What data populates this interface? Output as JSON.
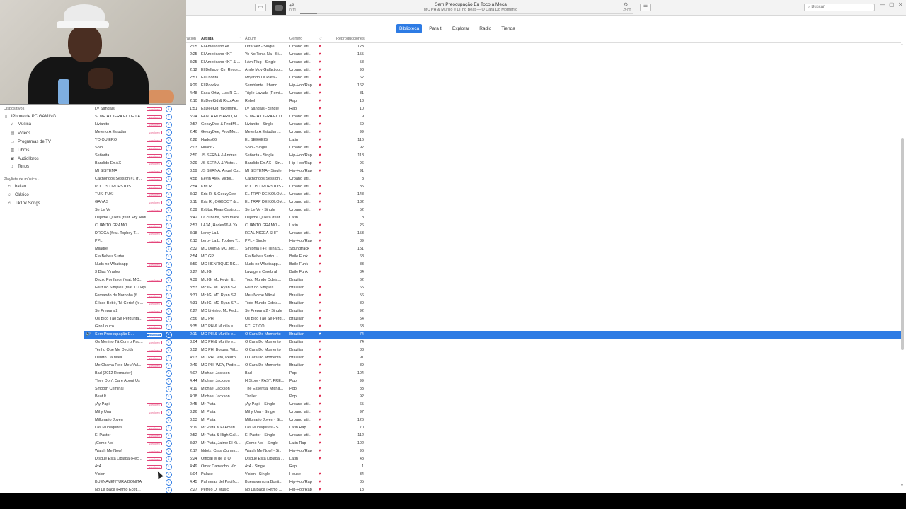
{
  "player": {
    "track_title": "Sem Preocupação Eu Toco a Meca",
    "track_subtitle": "MC PH & Murillo e LT no Beat — O Cara Do Momento",
    "elapsed": "0:11",
    "remaining": "-2:00",
    "progress_fraction": 0.05,
    "search_placeholder": "Buscar"
  },
  "tabs": [
    {
      "label": "Biblioteca",
      "active": true
    },
    {
      "label": "Para ti",
      "active": false
    },
    {
      "label": "Explorar",
      "active": false
    },
    {
      "label": "Radio",
      "active": false
    },
    {
      "label": "Tienda",
      "active": false
    }
  ],
  "sidebar": {
    "devices_heading": "Dispositivos",
    "device_name": "iPhone de PC GAMING",
    "device_items": [
      "Música",
      "Videos",
      "Programas de TV",
      "Libros",
      "Audiolibros",
      "Tonos"
    ],
    "playlists_heading": "Playlists de música",
    "playlists": [
      "bailao",
      "Clásico",
      "TikTok Songs"
    ]
  },
  "columns": {
    "duration": "ración",
    "artist": "Artista",
    "album": "Álbum",
    "genre": "Género",
    "plays": "Reproducciones"
  },
  "explicit_label": "EXPLÍCITO",
  "songs": [
    {
      "name": "",
      "explicit": false,
      "cloud": false,
      "time": "2:05",
      "artist": "El Americano 4KT",
      "album": "Otra Vez - Single",
      "genre": "Urbano lati...",
      "loved": true,
      "plays": "123"
    },
    {
      "name": "",
      "explicit": false,
      "cloud": false,
      "time": "2:25",
      "artist": "El Americano 4KT",
      "album": "Yo No Tenia Na - Si...",
      "genre": "Urbano lati...",
      "loved": true,
      "plays": "155"
    },
    {
      "name": "",
      "explicit": false,
      "cloud": false,
      "time": "3:25",
      "artist": "El Americano 4KT & ...",
      "album": "I Am Plug - Single",
      "genre": "Urbano lati...",
      "loved": true,
      "plays": "58"
    },
    {
      "name": "",
      "explicit": false,
      "cloud": false,
      "time": "2:12",
      "artist": "El Bellaco, Cm Recor...",
      "album": "Ando Muy Galáctico...",
      "genre": "Urbano lati...",
      "loved": true,
      "plays": "93"
    },
    {
      "name": "",
      "explicit": false,
      "cloud": false,
      "time": "2:51",
      "artist": "El Chonta",
      "album": "Mojando La Rata - ...",
      "genre": "Urbano lati...",
      "loved": true,
      "plays": "62"
    },
    {
      "name": "",
      "explicit": false,
      "cloud": false,
      "time": "4:29",
      "artist": "El Roockie",
      "album": "Semblante Urbano",
      "genre": "Hip-Hop/Rap",
      "loved": true,
      "plays": "162"
    },
    {
      "name": "",
      "explicit": false,
      "cloud": false,
      "time": "4:48",
      "artist": "Esau Ortiz, Luis R C...",
      "album": "Triple Lavada (Remi...",
      "genre": "Urbano lati...",
      "loved": true,
      "plays": "81"
    },
    {
      "name": "",
      "explicit": false,
      "cloud": false,
      "time": "2:10",
      "artist": "EsDeeKid & Rico Ace",
      "album": "Rebel",
      "genre": "Rap",
      "loved": true,
      "plays": "13"
    },
    {
      "name": "LV Sandals",
      "explicit": true,
      "cloud": true,
      "time": "1:51",
      "artist": "EsDeeKid, fakemink...",
      "album": "LV Sandals - Single",
      "genre": "Rap",
      "loved": true,
      "plays": "10"
    },
    {
      "name": "SI ME HICIERA EL DE LA...",
      "explicit": true,
      "cloud": true,
      "time": "5:24",
      "artist": "FANTA ROSARIO, H...",
      "album": "SI ME HICIERA EL D...",
      "genre": "Urbano lati...",
      "loved": true,
      "plays": "9"
    },
    {
      "name": "Livianito",
      "explicit": true,
      "cloud": true,
      "time": "2:57",
      "artist": "GeezyDee & ProdM...",
      "album": "Livianito - Single",
      "genre": "Urbano lati...",
      "loved": true,
      "plays": "69"
    },
    {
      "name": "Meterlo A Estudiar",
      "explicit": true,
      "cloud": true,
      "time": "2:46",
      "artist": "GeezyDee, ProdMo...",
      "album": "Meterlo A Estudiar ...",
      "genre": "Urbano lati...",
      "loved": true,
      "plays": "99"
    },
    {
      "name": "YO QUIERO",
      "explicit": true,
      "cloud": true,
      "time": "2:28",
      "artist": "Hades66",
      "album": "EL SEI66EIS",
      "genre": "Latin",
      "loved": true,
      "plays": "116"
    },
    {
      "name": "Solo",
      "explicit": true,
      "cloud": true,
      "time": "2:03",
      "artist": "Huan62",
      "album": "Solo - Single",
      "genre": "Urbano lati...",
      "loved": true,
      "plays": "92"
    },
    {
      "name": "Señorita",
      "explicit": true,
      "cloud": true,
      "time": "2:50",
      "artist": "JS SERNA & Andres...",
      "album": "Señorita - Single",
      "genre": "Hip-Hop/Rap",
      "loved": true,
      "plays": "118"
    },
    {
      "name": "Bandido En AX",
      "explicit": true,
      "cloud": true,
      "time": "2:29",
      "artist": "JS SERNA & Victor...",
      "album": "Bandido En AX - Sin...",
      "genre": "Hip-Hop/Rap",
      "loved": true,
      "plays": "96"
    },
    {
      "name": "MI SISTEMA",
      "explicit": true,
      "cloud": true,
      "time": "3:59",
      "artist": "JS SERNA, Angel Co...",
      "album": "MI SISTEMA - Single",
      "genre": "Hip-Hop/Rap",
      "loved": true,
      "plays": "91"
    },
    {
      "name": "Cachondos Session #1 (f...",
      "explicit": true,
      "cloud": true,
      "time": "4:58",
      "artist": "Kevin AMF, Victor...",
      "album": "Cachondos Session...",
      "genre": "Urbano lati...",
      "loved": false,
      "plays": "3"
    },
    {
      "name": "POLOS OPUESTOS",
      "explicit": true,
      "cloud": true,
      "time": "2:54",
      "artist": "Kris R.",
      "album": "POLOS OPUESTOS - ...",
      "genre": "Urbano lati...",
      "loved": true,
      "plays": "85"
    },
    {
      "name": "TUKI TUKI",
      "explicit": true,
      "cloud": true,
      "time": "3:12",
      "artist": "Kris R. & GeezyDee",
      "album": "EL TRAP DE KOLOM...",
      "genre": "Urbano lati...",
      "loved": true,
      "plays": "148"
    },
    {
      "name": "GANAS",
      "explicit": true,
      "cloud": true,
      "time": "3:11",
      "artist": "Kris R., OGBOOY &...",
      "album": "EL TRAP DE KOLOM...",
      "genre": "Urbano lati...",
      "loved": true,
      "plays": "132"
    },
    {
      "name": "Se Le Ve",
      "explicit": true,
      "cloud": true,
      "time": "2:39",
      "artist": "Kybba, Ryan Castro,...",
      "album": "Se Le Ve - Single",
      "genre": "Urbano lati...",
      "loved": true,
      "plays": "52"
    },
    {
      "name": "Dejeme Quieta (feat. Pty Audio)",
      "explicit": false,
      "cloud": true,
      "time": "3:42",
      "artist": "La cubana, nvm make...",
      "album": "Dejeme Quieta (feat...",
      "genre": "Latin",
      "loved": false,
      "plays": "8"
    },
    {
      "name": "CUÁNTO GRAMO",
      "explicit": true,
      "cloud": true,
      "time": "2:57",
      "artist": "LA3A, Hades66 & Ya...",
      "album": "CUÁNTO GRAMO - ...",
      "genre": "Latin",
      "loved": true,
      "plays": "26"
    },
    {
      "name": "DROGA (feat. Topboy T...",
      "explicit": true,
      "cloud": true,
      "time": "3:18",
      "artist": "Leroy La L",
      "album": "REAL NIGGA SHIT",
      "genre": "Urbano lati...",
      "loved": true,
      "plays": "153"
    },
    {
      "name": "PPL",
      "explicit": true,
      "cloud": true,
      "time": "2:13",
      "artist": "Leroy La L, Topboy T...",
      "album": "PPL - Single",
      "genre": "Hip-Hop/Rap",
      "loved": true,
      "plays": "89"
    },
    {
      "name": "Milagre",
      "explicit": false,
      "cloud": true,
      "time": "2:32",
      "artist": "MC Dom & MC Jott...",
      "album": "Sintonia T4 (Trilha S...",
      "genre": "Soundtrack",
      "loved": true,
      "plays": "151"
    },
    {
      "name": "Ela Bebeu Surtou",
      "explicit": false,
      "cloud": true,
      "time": "2:54",
      "artist": "MC GP",
      "album": "Ela Bebeu Surtou - ...",
      "genre": "Baile Funk",
      "loved": true,
      "plays": "68"
    },
    {
      "name": "Nuds no Whatsapp",
      "explicit": true,
      "cloud": true,
      "time": "3:50",
      "artist": "MC HENRIQUE RK...",
      "album": "Nuds no Whatsapp...",
      "genre": "Baile Funk",
      "loved": true,
      "plays": "83"
    },
    {
      "name": "3 Dias Virados",
      "explicit": false,
      "cloud": true,
      "time": "3:27",
      "artist": "Mc IG",
      "album": "Lavagem Cerebral",
      "genre": "Baile Funk",
      "loved": true,
      "plays": "84"
    },
    {
      "name": "Dezo, Por favor (feat. MC...",
      "explicit": true,
      "cloud": true,
      "time": "4:39",
      "artist": "Mc IG, Mc Kevin &...",
      "album": "Todo Mundo Odeia...",
      "genre": "Brazilian",
      "loved": false,
      "plays": "62"
    },
    {
      "name": "Feliz no Simples (feat. DJ Hyago)...",
      "explicit": false,
      "cloud": true,
      "time": "3:53",
      "artist": "Mc IG, MC Ryan SP...",
      "album": "Feliz no Simples",
      "genre": "Brazilian",
      "loved": true,
      "plays": "65"
    },
    {
      "name": "Fernando de Noronha (f...",
      "explicit": true,
      "cloud": true,
      "time": "8:31",
      "artist": "Mc IG, MC Ryan SP...",
      "album": "Meu Nome Não é L...",
      "genre": "Brazilian",
      "loved": true,
      "plays": "56"
    },
    {
      "name": "É Isso Bebê, Tá Certo! (fe...",
      "explicit": true,
      "cloud": true,
      "time": "4:31",
      "artist": "Mc IG, MC Ryan SP...",
      "album": "Todo Mundo Odeia...",
      "genre": "Brazilian",
      "loved": true,
      "plays": "80"
    },
    {
      "name": "Se Prepara 2",
      "explicit": true,
      "cloud": true,
      "time": "2:27",
      "artist": "MC Livinho, Mc Ped...",
      "album": "Se Prepara 2 - Single",
      "genre": "Brazilian",
      "loved": true,
      "plays": "92"
    },
    {
      "name": "Os Bico Tão Se Perguntа...",
      "explicit": true,
      "cloud": true,
      "time": "2:56",
      "artist": "MC PH",
      "album": "Os Bico Tão Se Perg...",
      "genre": "Brazilian",
      "loved": true,
      "plays": "54"
    },
    {
      "name": "Giro Louco",
      "explicit": true,
      "cloud": true,
      "time": "3:35",
      "artist": "MC PH & Murillo e...",
      "album": "ECLÉTICO",
      "genre": "Brazilian",
      "loved": true,
      "plays": "63"
    },
    {
      "name": "Sem Preocupação E...",
      "explicit": true,
      "cloud": true,
      "time": "2:11",
      "artist": "MC PH & Murillo e...",
      "album": "O Cara Do Momento",
      "genre": "Brazilian",
      "loved": true,
      "plays": "74",
      "selected": true
    },
    {
      "name": "Os Menino Tá Com o Pac...",
      "explicit": true,
      "cloud": true,
      "time": "3:04",
      "artist": "MC PH & Murillo e...",
      "album": "O Cara Do Momento",
      "genre": "Brazilian",
      "loved": true,
      "plays": "74"
    },
    {
      "name": "Tenho Que Me Decidir",
      "explicit": true,
      "cloud": true,
      "time": "3:52",
      "artist": "MC PH, Borges, WI...",
      "album": "O Cara Do Momento",
      "genre": "Brazilian",
      "loved": true,
      "plays": "83"
    },
    {
      "name": "Dentro Da Mala",
      "explicit": true,
      "cloud": true,
      "time": "4:03",
      "artist": "MC PH, Teto, Pedro...",
      "album": "O Cara Do Momento",
      "genre": "Brazilian",
      "loved": true,
      "plays": "91"
    },
    {
      "name": "Me Chama Pelo Meu Vul...",
      "explicit": true,
      "cloud": true,
      "time": "2:49",
      "artist": "MC PH, WEY, Pedro...",
      "album": "O Cara Do Momento",
      "genre": "Brazilian",
      "loved": true,
      "plays": "89"
    },
    {
      "name": "Bad (2012 Remaster)",
      "explicit": false,
      "cloud": true,
      "time": "4:07",
      "artist": "Michael Jackson",
      "album": "Bad",
      "genre": "Pop",
      "loved": true,
      "plays": "104"
    },
    {
      "name": "They Don't Care About Us",
      "explicit": false,
      "cloud": true,
      "time": "4:44",
      "artist": "Michael Jackson",
      "album": "HIStory - PAST, PRE...",
      "genre": "Pop",
      "loved": true,
      "plays": "99"
    },
    {
      "name": "Smooth Criminal",
      "explicit": false,
      "cloud": true,
      "time": "4:19",
      "artist": "Michael Jackson",
      "album": "The Essential Micha...",
      "genre": "Pop",
      "loved": true,
      "plays": "83"
    },
    {
      "name": "Beat It",
      "explicit": false,
      "cloud": true,
      "time": "4:18",
      "artist": "Michael Jackson",
      "album": "Thriller",
      "genre": "Pop",
      "loved": true,
      "plays": "92"
    },
    {
      "name": "¡Ay Papi!",
      "explicit": true,
      "cloud": true,
      "time": "2:45",
      "artist": "Mr Plata",
      "album": "¡Ay Papi! - Single",
      "genre": "Urbano lati...",
      "loved": true,
      "plays": "65"
    },
    {
      "name": "Mil y Una",
      "explicit": true,
      "cloud": true,
      "time": "3:26",
      "artist": "Mr Plata",
      "album": "Mil y Una - Single",
      "genre": "Urbano lati...",
      "loved": true,
      "plays": "97"
    },
    {
      "name": "Millonario Joven",
      "explicit": false,
      "cloud": true,
      "time": "3:53",
      "artist": "Mr Plata",
      "album": "Millonario Joven - Si...",
      "genre": "Urbano lati...",
      "loved": true,
      "plays": "126"
    },
    {
      "name": "Las Muñequitas",
      "explicit": true,
      "cloud": true,
      "time": "3:19",
      "artist": "Mr Plata & El Ameri...",
      "album": "Las Muñequitas - S...",
      "genre": "Latin Rap",
      "loved": true,
      "plays": "70"
    },
    {
      "name": "El Pastor",
      "explicit": true,
      "cloud": true,
      "time": "2:52",
      "artist": "Mr Plata & High Gal...",
      "album": "El Pastor - Single",
      "genre": "Urbano lati...",
      "loved": true,
      "plays": "112"
    },
    {
      "name": "¡Como No!",
      "explicit": true,
      "cloud": true,
      "time": "3:37",
      "artist": "Mr Plata, Jaime El Ki...",
      "album": "¡Como No! - Single",
      "genre": "Latin Rap",
      "loved": true,
      "plays": "102"
    },
    {
      "name": "Watch Me Now!",
      "explicit": true,
      "cloud": true,
      "time": "2:17",
      "artist": "Ndotz, CrashDumm...",
      "album": "Watch Me Now! - Si...",
      "genre": "Hip-Hop/Rap",
      "loved": true,
      "plays": "96"
    },
    {
      "name": "Disque Esta Lipiada (Hec...",
      "explicit": true,
      "cloud": true,
      "time": "5:24",
      "artist": "Official el de la O",
      "album": "Disque Esta Lipiada ...",
      "genre": "Latin",
      "loved": true,
      "plays": "48"
    },
    {
      "name": "4x4",
      "explicit": true,
      "cloud": true,
      "time": "4:49",
      "artist": "Omar Camacho, Vic...",
      "album": "4x4 - Single",
      "genre": "Rap",
      "loved": false,
      "plays": "1"
    },
    {
      "name": "Vision",
      "explicit": false,
      "cloud": true,
      "time": "5:04",
      "artist": "Palace",
      "album": "Vision - Single",
      "genre": "House",
      "loved": true,
      "plays": "34"
    },
    {
      "name": "BUENAVENTURA BONITA",
      "explicit": false,
      "cloud": true,
      "time": "4:45",
      "artist": "Palmeras del Pacific...",
      "album": "Buenaventura Bonit...",
      "genre": "Hip-Hop/Rap",
      "loved": true,
      "plays": "85"
    },
    {
      "name": "No La Baca (Ritmo Ecóti...",
      "explicit": false,
      "cloud": true,
      "time": "2:27",
      "artist": "Perreo Di Music",
      "album": "No La Baca (Ritmo ...",
      "genre": "Hip-Hop/Rap",
      "loved": true,
      "plays": "18"
    }
  ]
}
